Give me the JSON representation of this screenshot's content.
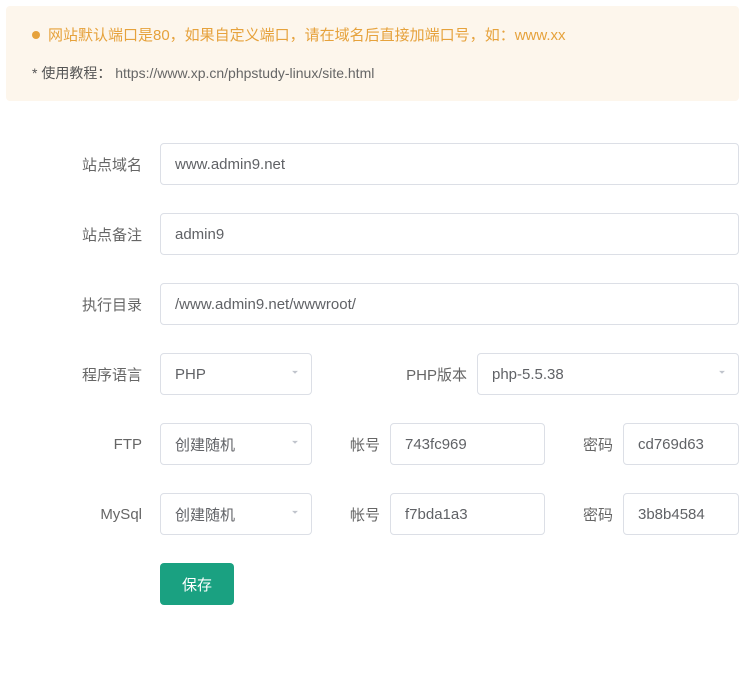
{
  "notice": {
    "line1": "网站默认端口是80，如果自定义端口，请在域名后直接加端口号，如：www.xx",
    "line2_prefix": "* 使用教程：",
    "line2_link": "https://www.xp.cn/phpstudy-linux/site.html"
  },
  "labels": {
    "site_domain": "站点域名",
    "site_remark": "站点备注",
    "exec_dir": "执行目录",
    "lang": "程序语言",
    "php_version": "PHP版本",
    "ftp": "FTP",
    "mysql": "MySql",
    "account": "帐号",
    "password": "密码",
    "save": "保存"
  },
  "values": {
    "site_domain": "www.admin9.net",
    "site_remark": "admin9",
    "exec_dir": "/www.admin9.net/wwwroot/",
    "lang": "PHP",
    "php_version": "php-5.5.38",
    "ftp_mode": "创建随机",
    "ftp_account": "743fc969",
    "ftp_password": "cd769d63",
    "mysql_mode": "创建随机",
    "mysql_account": "f7bda1a3",
    "mysql_password": "3b8b4584"
  }
}
